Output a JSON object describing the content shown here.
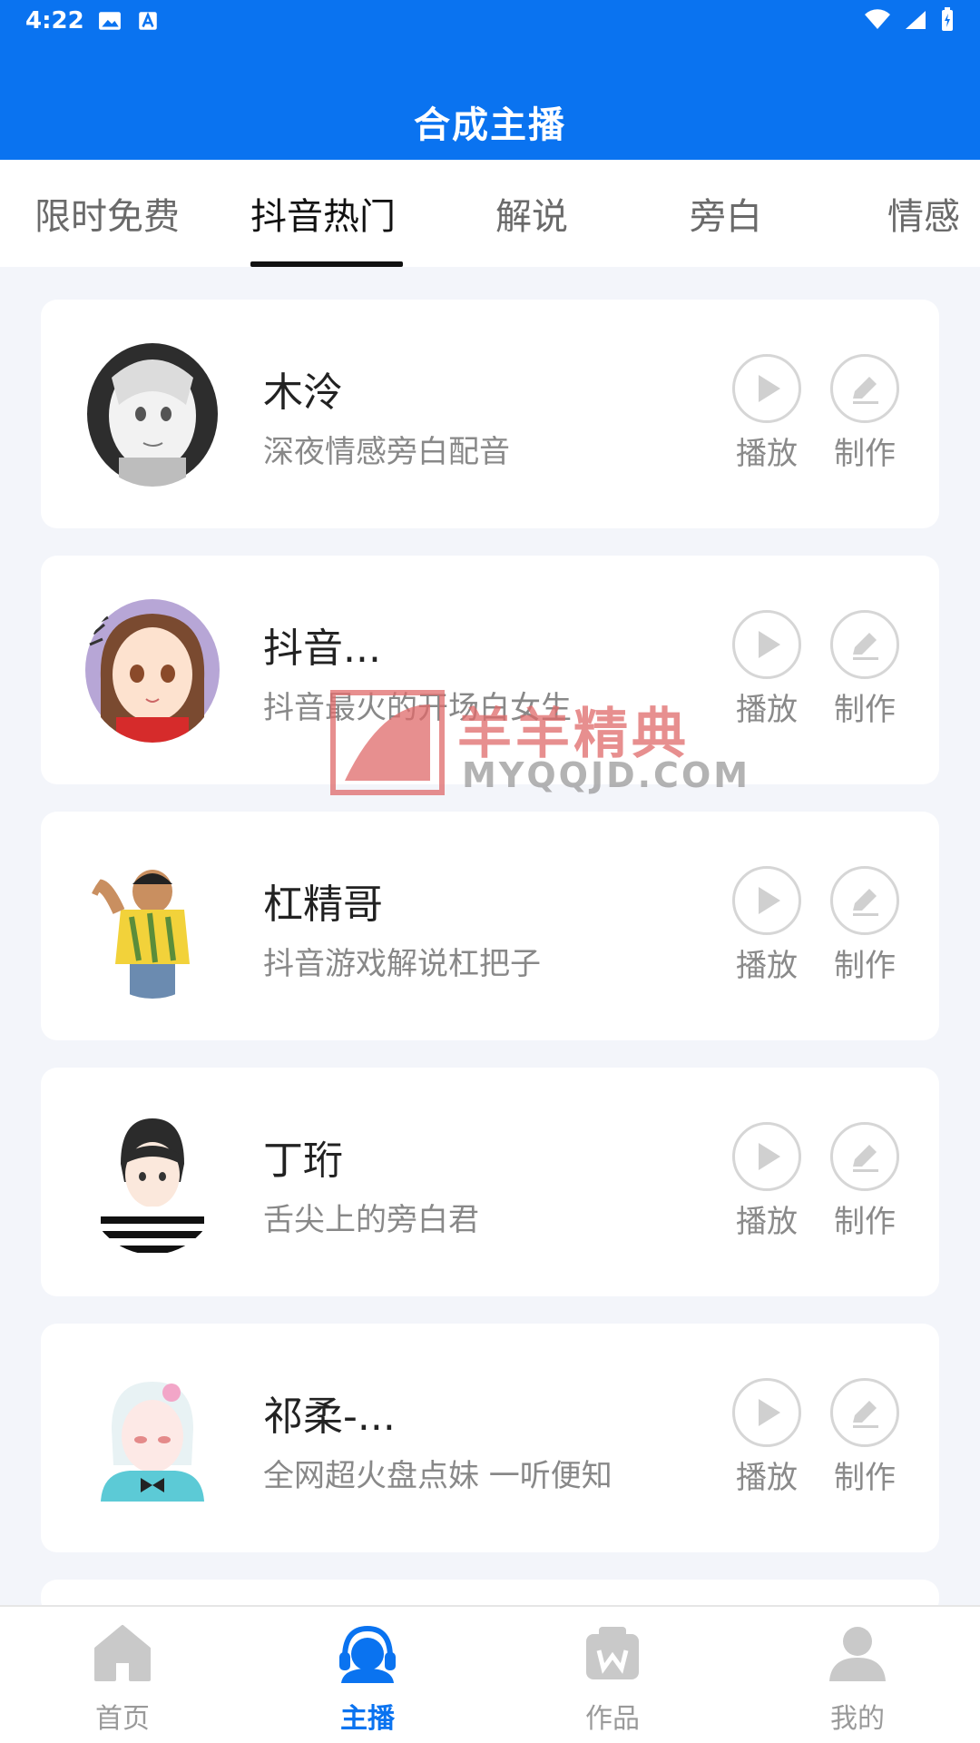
{
  "status": {
    "time": "4:22"
  },
  "header": {
    "title": "合成主播"
  },
  "tabs": [
    {
      "label": "限时免费"
    },
    {
      "label": "抖音热门"
    },
    {
      "label": "解说"
    },
    {
      "label": "旁白"
    },
    {
      "label": "情感"
    }
  ],
  "cards": [
    {
      "name": "木泠",
      "desc": "深夜情感旁白配音",
      "play": "播放",
      "make": "制作"
    },
    {
      "name": "抖音...",
      "desc": "抖音最火的开场白女生",
      "play": "播放",
      "make": "制作"
    },
    {
      "name": "杠精哥",
      "desc": "抖音游戏解说杠把子",
      "play": "播放",
      "make": "制作"
    },
    {
      "name": "丁珩",
      "desc": "舌尖上的旁白君",
      "play": "播放",
      "make": "制作"
    },
    {
      "name": "祁柔-...",
      "desc": "全网超火盘点妹 一听便知",
      "play": "播放",
      "make": "制作"
    }
  ],
  "watermark": {
    "text": "羊羊精典",
    "sub": "MYQQJD.COM"
  },
  "nav": [
    {
      "label": "首页",
      "icon": "home-icon"
    },
    {
      "label": "主播",
      "icon": "headset-icon"
    },
    {
      "label": "作品",
      "icon": "works-icon"
    },
    {
      "label": "我的",
      "icon": "person-icon"
    }
  ],
  "colors": {
    "primary": "#0a73f0",
    "background": "#f3f5fa"
  }
}
